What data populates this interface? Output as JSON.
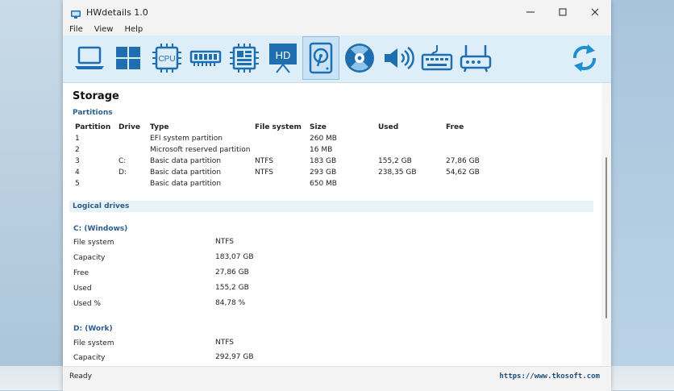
{
  "window": {
    "title": "HWdetails 1.0"
  },
  "menu": [
    "File",
    "View",
    "Help"
  ],
  "toolbar": {
    "icons": [
      "laptop-icon",
      "windows-icon",
      "cpu-icon",
      "ram-icon",
      "motherboard-icon",
      "display-icon",
      "storage-icon",
      "optical-drive-icon",
      "speaker-icon",
      "keyboard-icon",
      "router-icon"
    ],
    "cpu_label": "CPU",
    "hd_label": "HD",
    "active": "storage-icon",
    "refresh_icon": "refresh-icon"
  },
  "content": {
    "title": "Storage",
    "partitions": {
      "heading": "Partitions",
      "columns": [
        "Partition",
        "Drive",
        "Type",
        "File system",
        "Size",
        "Used",
        "Free"
      ],
      "rows": [
        [
          "1",
          "",
          "EFI system partition",
          "",
          "260 MB",
          "",
          ""
        ],
        [
          "2",
          "",
          "Microsoft reserved partition",
          "",
          "16 MB",
          "",
          ""
        ],
        [
          "3",
          "C:",
          "Basic data partition",
          "NTFS",
          "183 GB",
          "155,2 GB",
          "27,86 GB"
        ],
        [
          "4",
          "D:",
          "Basic data partition",
          "NTFS",
          "293 GB",
          "238,35 GB",
          "54,62 GB"
        ],
        [
          "5",
          "",
          "Basic data partition",
          "",
          "650 MB",
          "",
          ""
        ]
      ]
    },
    "logical": {
      "heading": "Logical drives",
      "drives": [
        {
          "title": "C: (Windows)",
          "props": [
            [
              "File system",
              "NTFS"
            ],
            [
              "Capacity",
              "183,07 GB"
            ],
            [
              "Free",
              "27,86 GB"
            ],
            [
              "Used",
              "155,2 GB"
            ],
            [
              "Used %",
              "84,78 %"
            ]
          ]
        },
        {
          "title": "D: (Work)",
          "props": [
            [
              "File system",
              "NTFS"
            ],
            [
              "Capacity",
              "292,97 GB"
            ]
          ]
        }
      ]
    }
  },
  "status": {
    "text": "Ready",
    "url": "https://www.tkosoft.com"
  },
  "colors": {
    "accent": "#2a5d8f",
    "toolbar_bg": "#deeef8",
    "icon": "#1f6fb0"
  }
}
